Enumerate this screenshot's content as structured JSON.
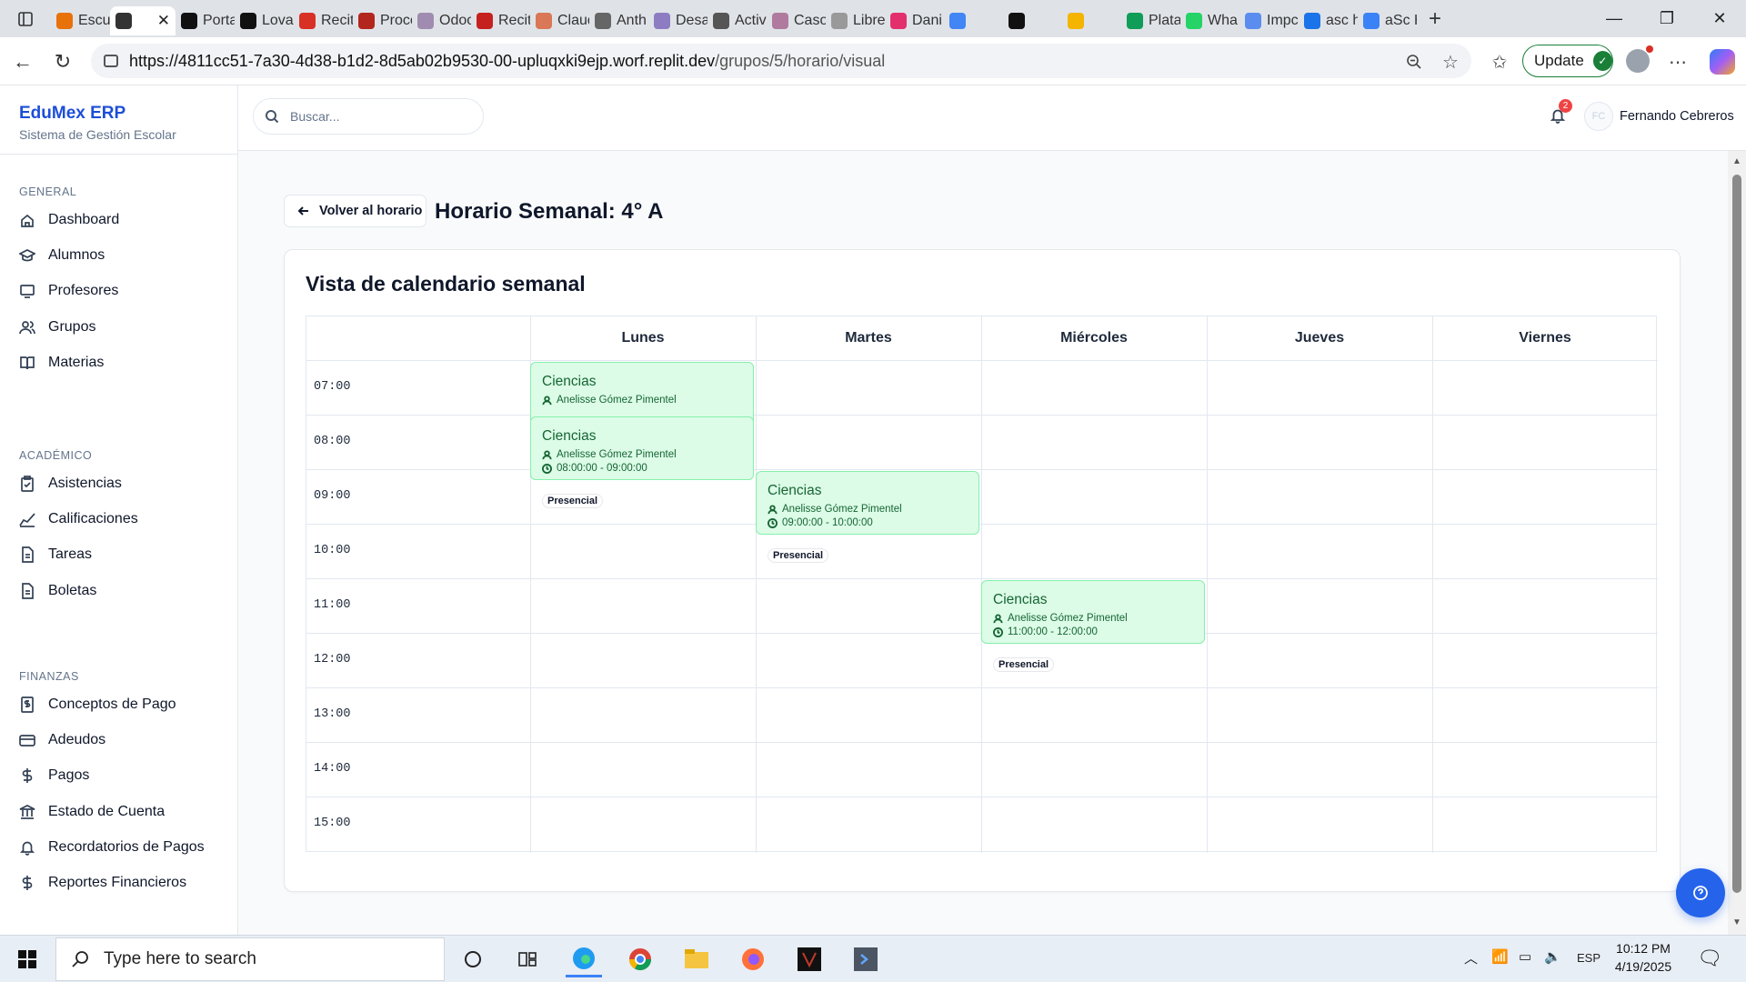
{
  "browser": {
    "tabs": [
      {
        "label": "Escu",
        "color": "#e8710a"
      },
      {
        "label": "",
        "color": "#333",
        "active": true
      },
      {
        "label": "Porta",
        "color": "#111"
      },
      {
        "label": "Loval",
        "color": "#111"
      },
      {
        "label": "Recit",
        "color": "#d93025"
      },
      {
        "label": "Proce",
        "color": "#b3261e"
      },
      {
        "label": "Odoo",
        "color": "#a08cb0"
      },
      {
        "label": "Recit",
        "color": "#c5221f"
      },
      {
        "label": "Claud",
        "color": "#d97757"
      },
      {
        "label": "Anth",
        "color": "#666"
      },
      {
        "label": "Desa",
        "color": "#8e7cc3"
      },
      {
        "label": "Activ",
        "color": "#555"
      },
      {
        "label": "Caso",
        "color": "#b07a9e"
      },
      {
        "label": "Libre",
        "color": "#999"
      },
      {
        "label": "Dani",
        "color": "#e3306c"
      },
      {
        "label": "",
        "color": "#4285f4"
      },
      {
        "label": "",
        "color": "#111"
      },
      {
        "label": "",
        "color": "#f4b400"
      },
      {
        "label": "Plata",
        "color": "#0f9d58"
      },
      {
        "label": "Wha",
        "color": "#25d366"
      },
      {
        "label": "Impc",
        "color": "#5b8def"
      },
      {
        "label": "asc h",
        "color": "#1a73e8"
      },
      {
        "label": "aSc H",
        "color": "#3b82f6"
      }
    ],
    "active_tab_close": "✕",
    "new_tab": "+",
    "url_host": "https://4811cc51-7a30-4d38-b1d2-8d5ab02b9530-00-upluqxki9ejp.worf.replit.dev",
    "url_path": "/grupos/5/horario/visual",
    "update_label": "Update"
  },
  "sidebar": {
    "brand_title": "EduMex ERP",
    "brand_subtitle": "Sistema de Gestión Escolar",
    "sections": [
      {
        "title": "GENERAL",
        "items": [
          "Dashboard",
          "Alumnos",
          "Profesores",
          "Grupos",
          "Materias"
        ]
      },
      {
        "title": "ACADÉMICO",
        "items": [
          "Asistencias",
          "Calificaciones",
          "Tareas",
          "Boletas"
        ]
      },
      {
        "title": "FINANZAS",
        "items": [
          "Conceptos de Pago",
          "Adeudos",
          "Pagos",
          "Estado de Cuenta",
          "Recordatorios de Pagos",
          "Reportes Financieros"
        ]
      }
    ]
  },
  "topbar": {
    "search_placeholder": "Buscar...",
    "notifications_count": "2",
    "user_initials": "FC",
    "user_name": "Fernando Cebreros"
  },
  "page": {
    "back_label": "Volver al horario",
    "title": "Horario Semanal: 4° A",
    "card_title": "Vista de calendario semanal"
  },
  "schedule": {
    "days": [
      "Lunes",
      "Martes",
      "Miércoles",
      "Jueves",
      "Viernes"
    ],
    "hours": [
      "07:00",
      "08:00",
      "09:00",
      "10:00",
      "11:00",
      "12:00",
      "13:00",
      "14:00",
      "15:00"
    ],
    "events": [
      {
        "day": 0,
        "hour": 0,
        "subject": "Ciencias",
        "teacher": "Anelisse Gómez Pimentel",
        "time": "",
        "mode": ""
      },
      {
        "day": 0,
        "hour": 1,
        "subject": "Ciencias",
        "teacher": "Anelisse Gómez Pimentel",
        "time": "08:00:00 - 09:00:00",
        "mode": "Presencial"
      },
      {
        "day": 1,
        "hour": 2,
        "subject": "Ciencias",
        "teacher": "Anelisse Gómez Pimentel",
        "time": "09:00:00 - 10:00:00",
        "mode": "Presencial"
      },
      {
        "day": 2,
        "hour": 4,
        "subject": "Ciencias",
        "teacher": "Anelisse Gómez Pimentel",
        "time": "11:00:00 - 12:00:00",
        "mode": "Presencial"
      }
    ]
  },
  "taskbar": {
    "search_placeholder": "Type here to search",
    "language": "ESP",
    "time": "10:12 PM",
    "date": "4/19/2025"
  },
  "colors": {
    "brand": "#1d4ed8",
    "event_bg": "#dcfce7",
    "event_border": "#86efac",
    "event_text": "#166534",
    "help_button": "#2563eb"
  }
}
